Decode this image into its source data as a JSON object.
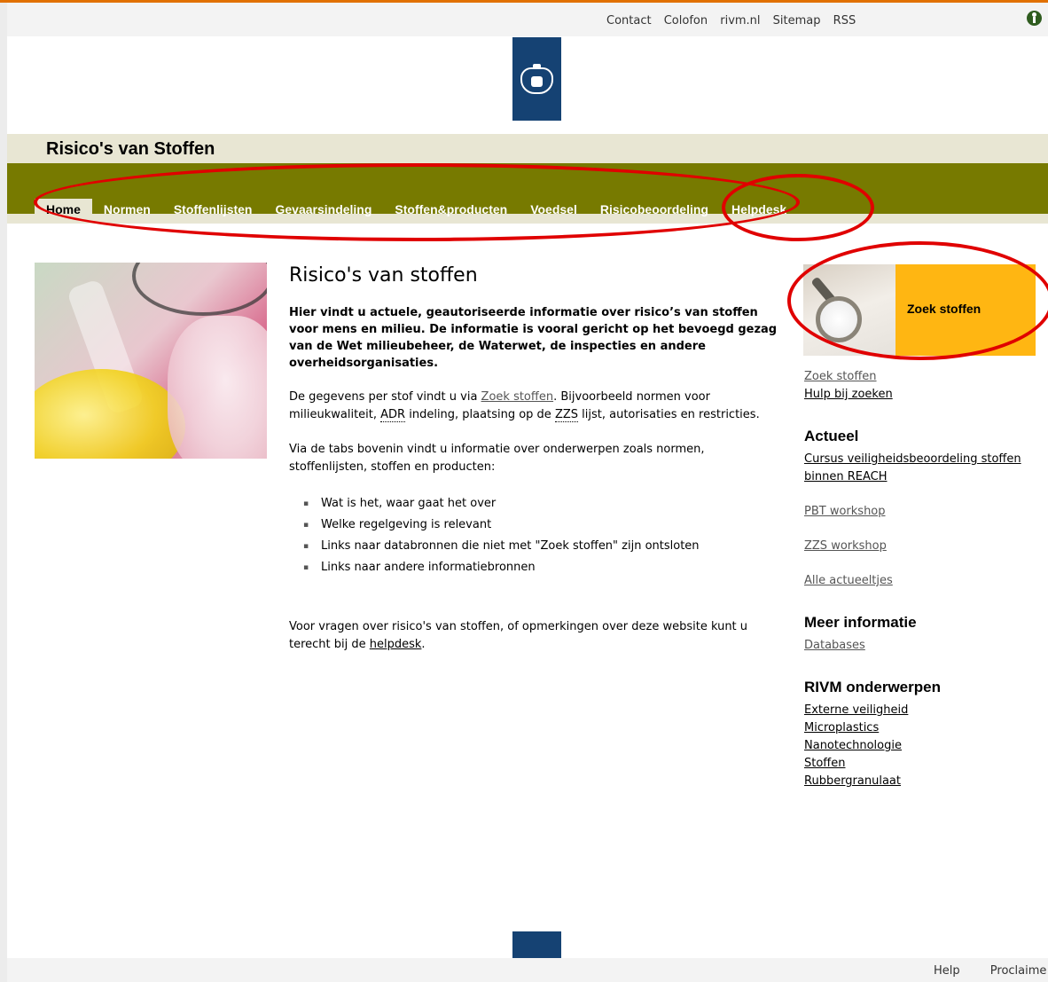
{
  "top_nav": {
    "links": [
      "Contact",
      "Colofon",
      "rivm.nl",
      "Sitemap",
      "RSS"
    ]
  },
  "site": {
    "title": "Risico's van Stoffen"
  },
  "nav": {
    "tabs": [
      {
        "label": "Home",
        "active": true
      },
      {
        "label": "Normen"
      },
      {
        "label": "Stoffenlijsten"
      },
      {
        "label": "Gevaarsindeling"
      },
      {
        "label": "Stoffen&producten"
      },
      {
        "label": "Voedsel"
      },
      {
        "label": "Risicobeoordeling"
      },
      {
        "label": "Helpdesk"
      }
    ]
  },
  "main": {
    "heading": "Risico's van stoffen",
    "intro": "Hier vindt u actuele, geautoriseerde informatie over risico’s van stoffen voor mens en milieu. De informatie is vooral gericht op het bevoegd gezag van de Wet milieubeheer, de Waterwet, de inspecties en andere overheidsorganisaties.",
    "p1_a": "De gegevens per stof vindt u via ",
    "p1_link": "Zoek stoffen",
    "p1_b": ". Bijvoorbeeld normen voor milieukwaliteit, ",
    "p1_adr": "ADR",
    "p1_c": " indeling, plaatsing op de ",
    "p1_zzs": "ZZS",
    "p1_d": " lijst, autorisaties en restricties.",
    "p2": "Via de tabs bovenin vindt u informatie over onderwerpen zoals normen, stoffenlijsten, stoffen en producten:",
    "bullets": [
      "Wat is het, waar gaat het over",
      "Welke regelgeving is relevant",
      "Links naar databronnen die niet met \"Zoek stoffen\" zijn ontsloten",
      "Links naar andere informatiebronnen"
    ],
    "p3_a": "Voor vragen over risico's van stoffen, of opmerkingen over deze website kunt u terecht bij de ",
    "p3_link": "helpdesk",
    "p3_b": "."
  },
  "sidebar": {
    "banner_label": "Zoek stoffen",
    "search_links": [
      "Zoek stoffen",
      "Hulp bij zoeken"
    ],
    "actueel_heading": "Actueel",
    "actueel_links": [
      "Cursus veiligheidsbeoordeling stoffen binnen REACH",
      "PBT workshop",
      "ZZS workshop",
      "Alle actueeltjes"
    ],
    "meer_heading": "Meer informatie",
    "meer_links": [
      "Databases"
    ],
    "rivm_heading": "RIVM onderwerpen",
    "rivm_links": [
      "Externe veiligheid",
      "Microplastics",
      "Nanotechnologie",
      "Stoffen",
      "Rubbergranulaat"
    ]
  },
  "footer": {
    "links": [
      "Help",
      "Proclaime"
    ]
  },
  "colors": {
    "nav_olive": "#777a00",
    "title_bar": "#e8e6d3",
    "logo_blue": "#154273",
    "banner_orange": "#ffb612",
    "annotation_red": "#e00000"
  }
}
